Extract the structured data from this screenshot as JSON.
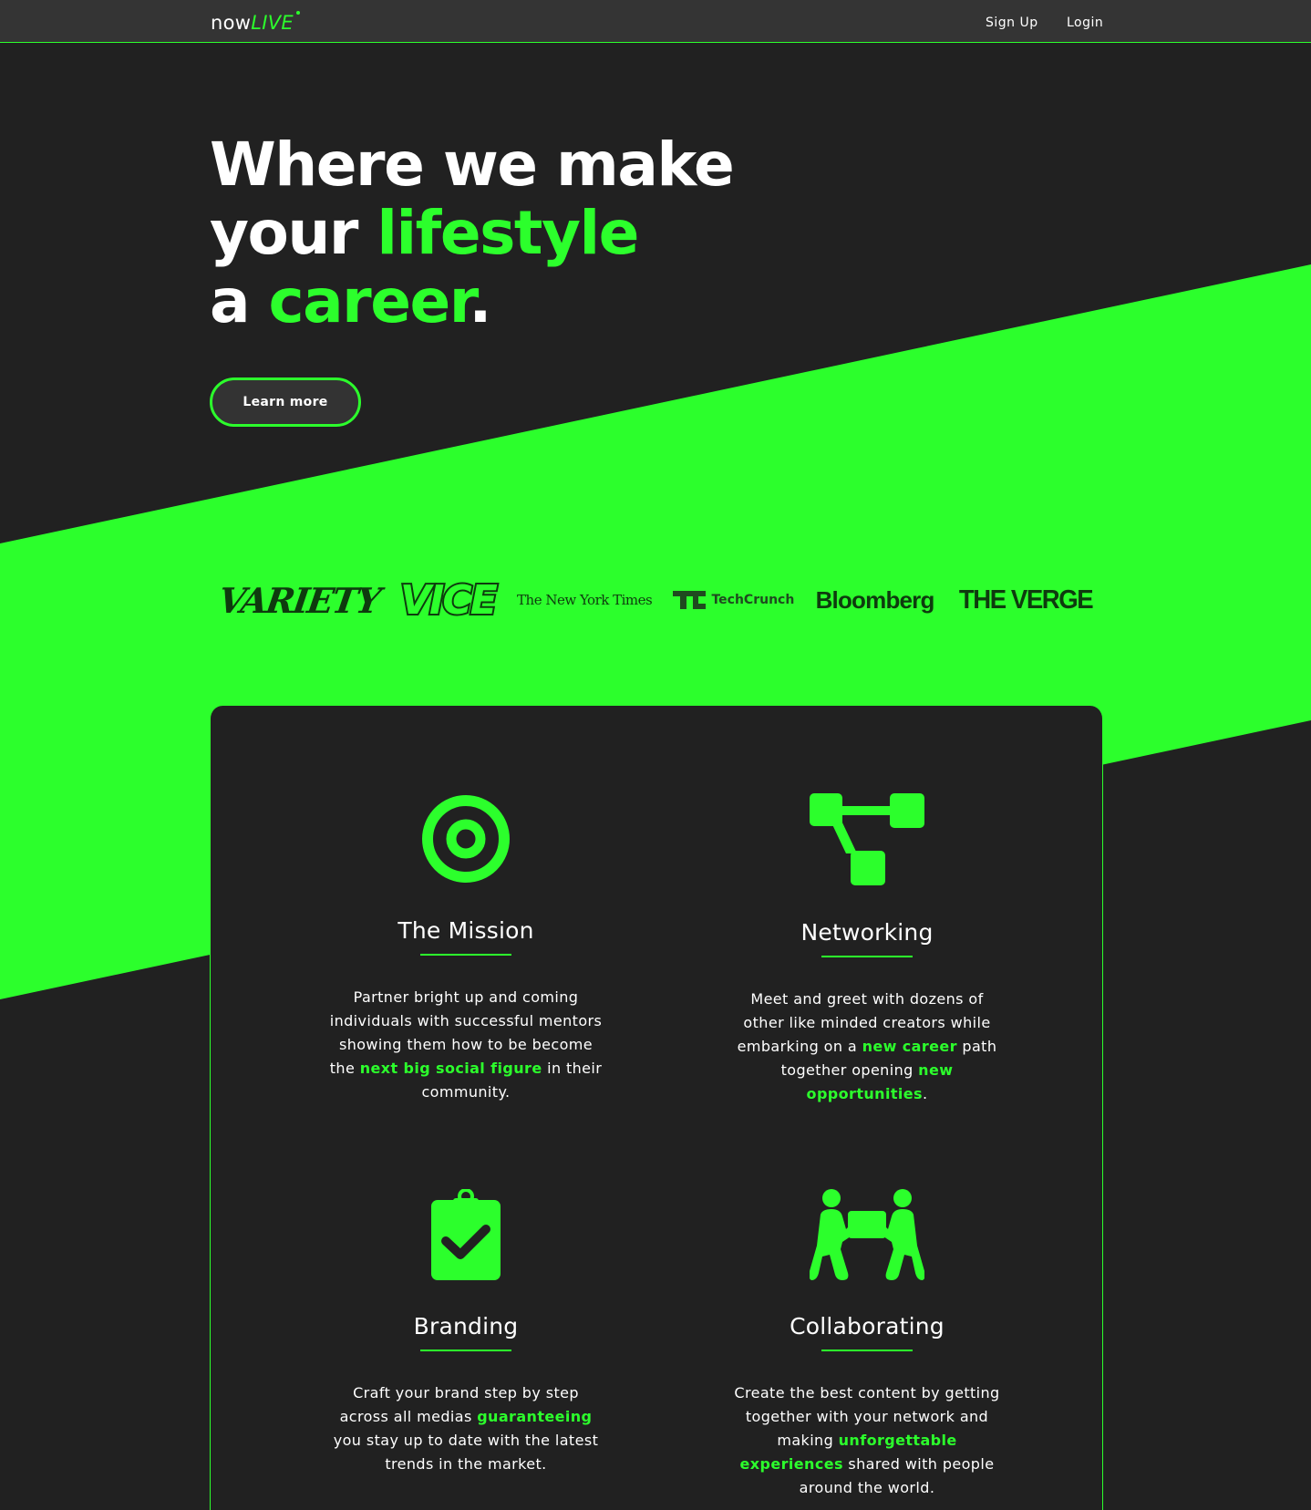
{
  "nav": {
    "brand_now": "now",
    "brand_live": "LIVE",
    "signup_label": "Sign Up",
    "login_label": "Login"
  },
  "hero": {
    "line1": "Where we make",
    "line2_a": "your ",
    "line2_b": "lifestyle",
    "line3_a": "a ",
    "line3_b": "career",
    "line3_c": ".",
    "button_label": "Learn more"
  },
  "press": {
    "variety": "VARIETY",
    "vice": "VICE",
    "nyt": "The New York Times",
    "techcrunch": "TechCrunch",
    "bloomberg": "Bloomberg",
    "verge": "THE VERGE"
  },
  "features": [
    {
      "icon": "target-icon",
      "title": "The Mission",
      "text_1": "Partner bright up and coming individuals with successful mentors showing them how to be become the ",
      "highlight_1": "next big social figure",
      "text_2": " in their community."
    },
    {
      "icon": "network-icon",
      "title": "Networking",
      "text_1": "Meet and greet with dozens of other like minded creators while embarking on a ",
      "highlight_1": "new career",
      "text_2": " path together opening ",
      "highlight_2": "new opportunities",
      "text_3": "."
    },
    {
      "icon": "clipboard-check-icon",
      "title": "Branding",
      "text_1": "Craft your brand step by step across all medias ",
      "highlight_1": "guaranteeing",
      "text_2": " you stay up to date with the latest trends in the market."
    },
    {
      "icon": "people-carry-icon",
      "title": "Collaborating",
      "text_1": "Create the best content by getting together with your network and making ",
      "highlight_1": "unforgettable experiences",
      "text_2": " shared with people around the world."
    }
  ],
  "colors": {
    "accent": "#2cff2c",
    "background": "#212121",
    "navbar": "#343434",
    "logo_dark": "#0e3b0e"
  }
}
